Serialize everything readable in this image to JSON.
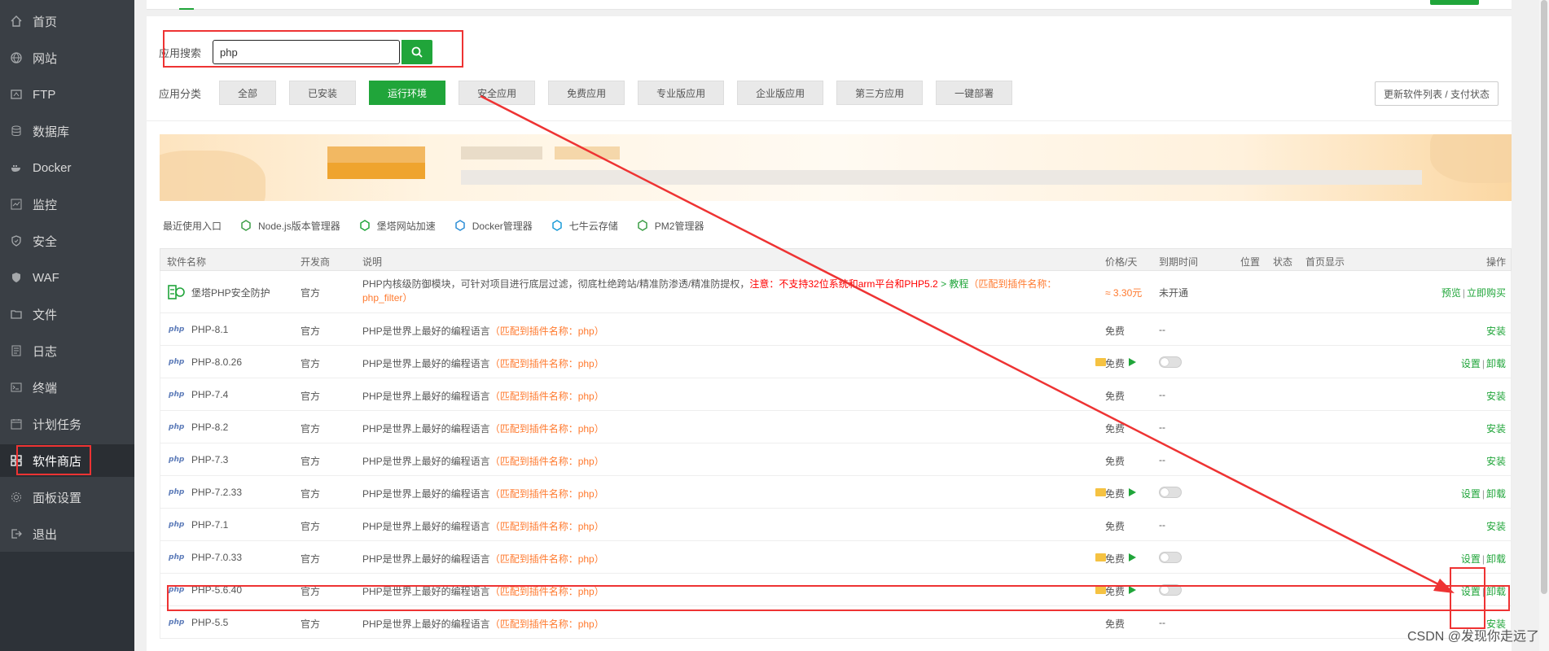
{
  "sidebar": {
    "items": [
      {
        "label": "首页",
        "icon": "home-icon"
      },
      {
        "label": "网站",
        "icon": "globe-icon"
      },
      {
        "label": "FTP",
        "icon": "ftp-icon"
      },
      {
        "label": "数据库",
        "icon": "database-icon"
      },
      {
        "label": "Docker",
        "icon": "docker-icon"
      },
      {
        "label": "监控",
        "icon": "monitor-icon"
      },
      {
        "label": "安全",
        "icon": "shield-icon"
      },
      {
        "label": "WAF",
        "icon": "waf-icon"
      },
      {
        "label": "文件",
        "icon": "folder-icon"
      },
      {
        "label": "日志",
        "icon": "log-icon"
      },
      {
        "label": "终端",
        "icon": "terminal-icon"
      },
      {
        "label": "计划任务",
        "icon": "calendar-icon"
      },
      {
        "label": "软件商店",
        "icon": "grid-icon",
        "active": true
      },
      {
        "label": "面板设置",
        "icon": "gear-icon"
      },
      {
        "label": "退出",
        "icon": "logout-icon"
      }
    ]
  },
  "search": {
    "label": "应用搜索",
    "value": "php"
  },
  "categories": {
    "label": "应用分类",
    "items": [
      "全部",
      "已安装",
      "运行环境",
      "安全应用",
      "免费应用",
      "专业版应用",
      "企业版应用",
      "第三方应用",
      "一键部署"
    ],
    "active": "运行环境"
  },
  "update_button": "更新软件列表 / 支付状态",
  "recent": {
    "label": "最近使用入口",
    "items": [
      "Node.js版本管理器",
      "堡塔网站加速",
      "Docker管理器",
      "七牛云存储",
      "PM2管理器"
    ]
  },
  "table": {
    "headers": {
      "name": "软件名称",
      "dev": "开发商",
      "desc": "说明",
      "price": "价格/天",
      "expire": "到期时间",
      "position": "位置",
      "status": "状态",
      "home": "首页显示",
      "ops": "操作"
    },
    "first_row": {
      "name": "堡塔PHP安全防护",
      "dev": "官方",
      "desc_main": "PHP内核级防御模块，可针对项目进行底层过滤，彻底杜绝跨站/精准防渗透/精准防提权，",
      "desc_warn": "注意：不支持32位系统和arm平台和PHP5.2",
      "desc_link": " > 教程",
      "desc_match_line1": "（匹配到插件名称：",
      "desc_match_line2": "php_filter）",
      "price": "≈ 3.30元",
      "expire": "未开通",
      "op_preview": "预览",
      "op_buy": "立即购买"
    },
    "desc_text": "PHP是世界上最好的编程语言",
    "match_text": "（匹配到插件名称：php）",
    "rows": [
      {
        "name": "PHP-8.1",
        "dev": "官方",
        "price": "免费",
        "expire": "--",
        "installed": false,
        "op": "安装"
      },
      {
        "name": "PHP-8.0.26",
        "dev": "官方",
        "price": "免费",
        "expire": "--",
        "installed": true,
        "op_set": "设置",
        "op_uninstall": "卸载"
      },
      {
        "name": "PHP-7.4",
        "dev": "官方",
        "price": "免费",
        "expire": "--",
        "installed": false,
        "op": "安装"
      },
      {
        "name": "PHP-8.2",
        "dev": "官方",
        "price": "免费",
        "expire": "--",
        "installed": false,
        "op": "安装"
      },
      {
        "name": "PHP-7.3",
        "dev": "官方",
        "price": "免费",
        "expire": "--",
        "installed": false,
        "op": "安装"
      },
      {
        "name": "PHP-7.2.33",
        "dev": "官方",
        "price": "免费",
        "expire": "--",
        "installed": true,
        "op_set": "设置",
        "op_uninstall": "卸载"
      },
      {
        "name": "PHP-7.1",
        "dev": "官方",
        "price": "免费",
        "expire": "--",
        "installed": false,
        "op": "安装"
      },
      {
        "name": "PHP-7.0.33",
        "dev": "官方",
        "price": "免费",
        "expire": "--",
        "installed": true,
        "op_set": "设置",
        "op_uninstall": "卸载"
      },
      {
        "name": "PHP-5.6.40",
        "dev": "官方",
        "price": "免费",
        "expire": "--",
        "installed": true,
        "op_set": "设置",
        "op_uninstall": "卸载"
      },
      {
        "name": "PHP-5.5",
        "dev": "官方",
        "price": "免费",
        "expire": "--",
        "installed": false,
        "op": "安装"
      }
    ]
  },
  "php_logo_text": "php",
  "watermark": "CSDN @发现你走远了",
  "colors": {
    "accent": "#20a53a",
    "sidebar": "#3a3f45",
    "annotation": "#e33333",
    "match": "#ff7a2f"
  }
}
